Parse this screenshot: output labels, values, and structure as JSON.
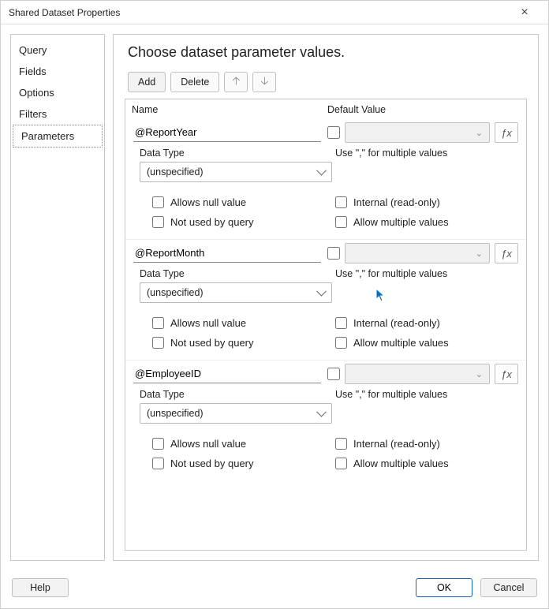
{
  "window": {
    "title": "Shared Dataset Properties"
  },
  "sidebar": {
    "items": [
      {
        "label": "Query"
      },
      {
        "label": "Fields"
      },
      {
        "label": "Options"
      },
      {
        "label": "Filters"
      },
      {
        "label": "Parameters"
      }
    ],
    "selectedIndex": 4
  },
  "content": {
    "heading": "Choose dataset parameter values.",
    "toolbar": {
      "add": "Add",
      "delete": "Delete"
    },
    "columns": {
      "name": "Name",
      "defaultValue": "Default Value"
    },
    "hint": "Use \",\" for multiple values",
    "labels": {
      "dataType": "Data Type",
      "allowsNull": "Allows null value",
      "notUsed": "Not used by query",
      "internal": "Internal (read-only)",
      "allowMulti": "Allow multiple values"
    },
    "params": [
      {
        "name": "@ReportYear",
        "dataType": "(unspecified)",
        "hasDefault": false,
        "allowsNull": false,
        "notUsed": false,
        "internal": false,
        "allowMulti": false
      },
      {
        "name": "@ReportMonth",
        "dataType": "(unspecified)",
        "hasDefault": false,
        "allowsNull": false,
        "notUsed": false,
        "internal": false,
        "allowMulti": false
      },
      {
        "name": "@EmployeeID",
        "dataType": "(unspecified)",
        "hasDefault": false,
        "allowsNull": false,
        "notUsed": false,
        "internal": false,
        "allowMulti": false
      }
    ]
  },
  "footer": {
    "help": "Help",
    "ok": "OK",
    "cancel": "Cancel"
  }
}
